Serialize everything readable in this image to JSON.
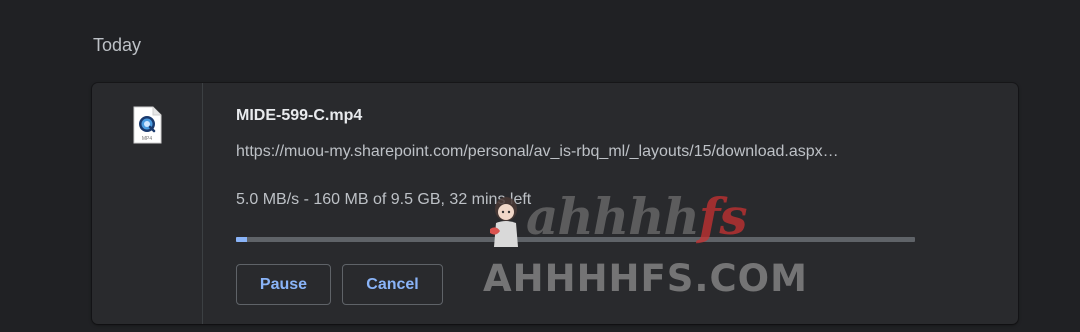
{
  "section": {
    "date_label": "Today"
  },
  "download": {
    "file_icon": "mp4-file-icon",
    "file_icon_label": "MP4",
    "file_name": "MIDE-599-C.mp4",
    "url": "https://muou-my.sharepoint.com/personal/av_is-rbq_ml/_layouts/15/download.aspx…",
    "status": "5.0 MB/s - 160 MB of 9.5 GB, 32 mins left",
    "progress_fraction": 0.0165,
    "pause_label": "Pause",
    "cancel_label": "Cancel"
  },
  "watermark": {
    "script_text": "ahhhhfs",
    "domain_text": "AHHHHFS.COM"
  },
  "colors": {
    "background": "#202124",
    "card": "#292a2d",
    "accent": "#8ab4f8",
    "track": "#5f6368"
  }
}
